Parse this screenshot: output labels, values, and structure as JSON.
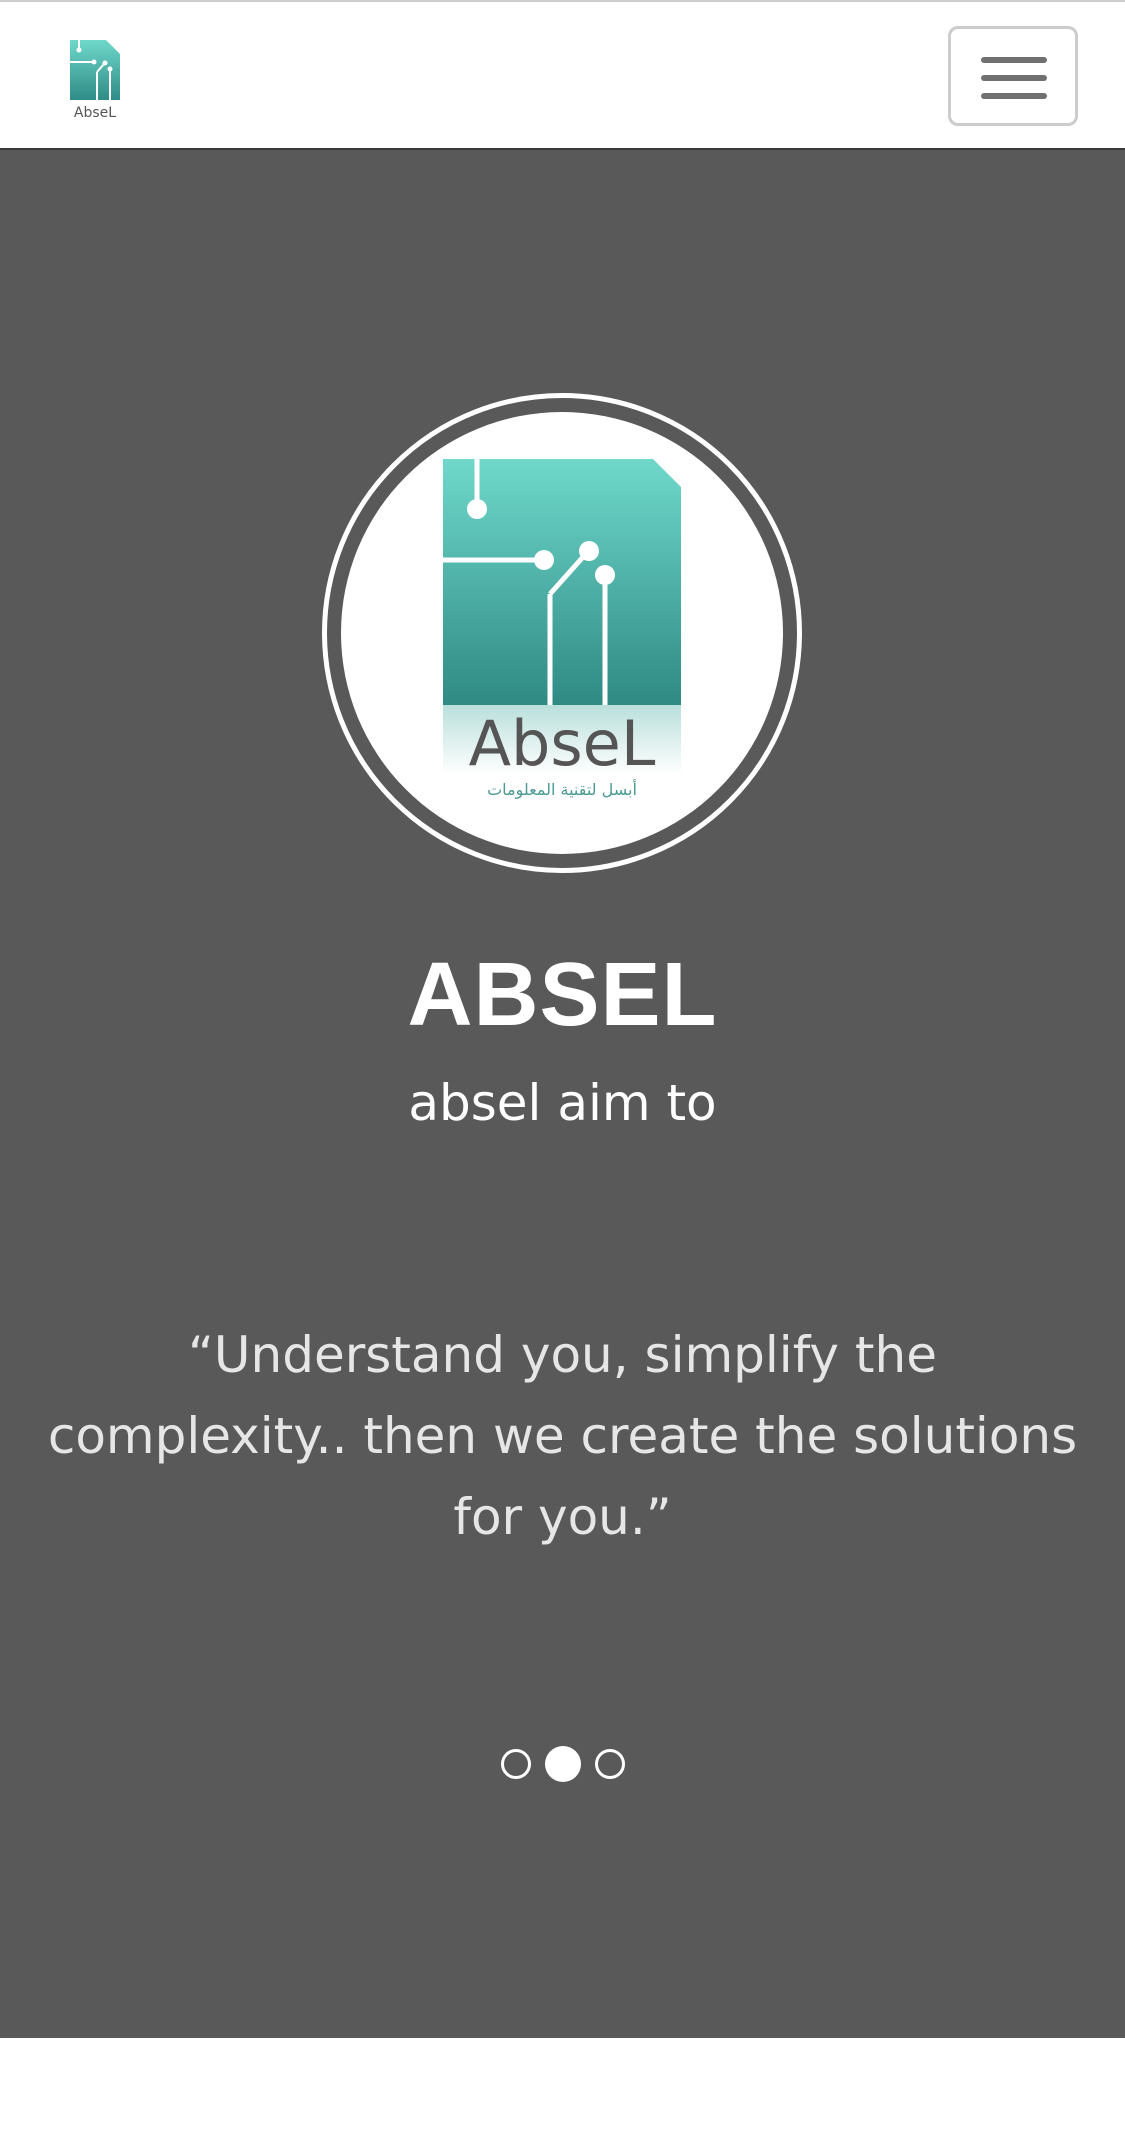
{
  "nav": {
    "logo_alt": "AbseL",
    "menu_toggle_icon": "hamburger-icon"
  },
  "hero": {
    "logo_text": "AbseL",
    "logo_tagline": "أبسل لتقنية المعلومات",
    "name": "ABSEL",
    "subtitle": "absel aim to",
    "quote": "“Understand you, simplify the complexity.. then we create the solutions for you.”",
    "carousel": {
      "slide_count": 3,
      "active_index": 1
    }
  },
  "colors": {
    "hero_background": "#595959",
    "brand_teal": "#4fb0a6",
    "brand_teal_light": "#6fd8cb"
  }
}
